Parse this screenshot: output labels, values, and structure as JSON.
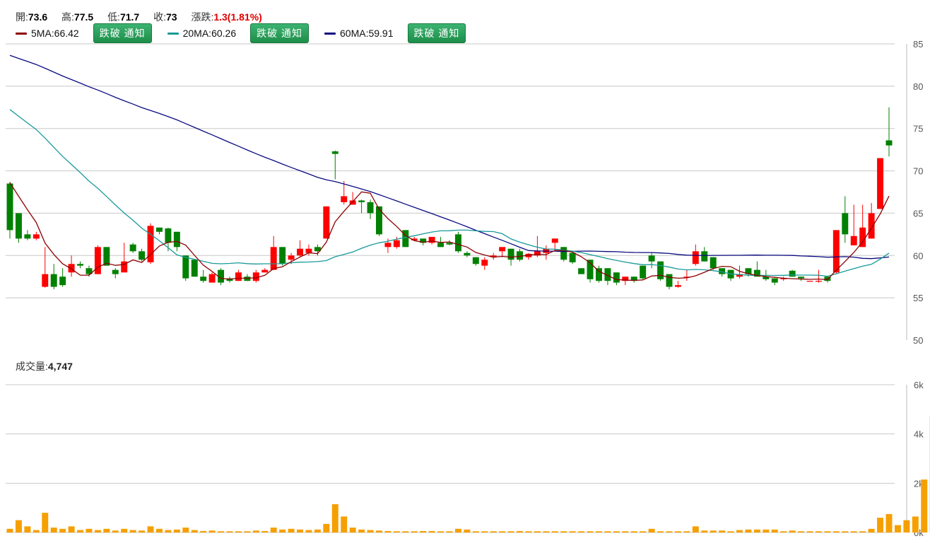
{
  "header": {
    "open_label": "開:",
    "open": "73.6",
    "high_label": "高:",
    "high": "77.5",
    "low_label": "低:",
    "low": "71.7",
    "close_label": "收:",
    "close": "73",
    "change_label": "漲跌:",
    "change": "1.3(1.81%)"
  },
  "ma": [
    {
      "label": "5MA:66.42",
      "color": "#8b0000"
    },
    {
      "label": "20MA:60.26",
      "color": "#1a9a9a"
    },
    {
      "label": "60MA:59.91",
      "color": "#0a0a80"
    }
  ],
  "alert_button_label": "跌破 通知",
  "volume_header": {
    "label": "成交量:",
    "value": "4,747"
  },
  "colors": {
    "up": "#ff0000",
    "down": "#008000",
    "volume": "#f5a000",
    "grid": "#c8c8c8"
  },
  "chart_data": [
    {
      "type": "candlestick",
      "ylim": [
        50,
        85
      ],
      "yticks": [
        "85",
        "80",
        "75",
        "70",
        "65",
        "60",
        "55",
        "50"
      ],
      "candles": [
        [
          68.5,
          63,
          68.7,
          62
        ],
        [
          65,
          62,
          65,
          61.5
        ],
        [
          62.5,
          62,
          63,
          61.8
        ],
        [
          62,
          62.5,
          62.8,
          61.8
        ],
        [
          56.3,
          57.8,
          61,
          56.2
        ],
        [
          57.8,
          56.3,
          59,
          56
        ],
        [
          57.5,
          56.5,
          58.5,
          56.3
        ],
        [
          58,
          59,
          60,
          57.5
        ],
        [
          59,
          58.8,
          59.3,
          58.5
        ],
        [
          58.5,
          57.8,
          58.8,
          57.5
        ],
        [
          57.8,
          61,
          61.2,
          57.8
        ],
        [
          61,
          58.8,
          61,
          58.8
        ],
        [
          58.3,
          57.8,
          58.5,
          57.3
        ],
        [
          58,
          59.3,
          61.5,
          58
        ],
        [
          61.3,
          60.5,
          61.5,
          60.3
        ],
        [
          60.5,
          59.5,
          60.8,
          59.3
        ],
        [
          59.2,
          63.5,
          63.8,
          59
        ],
        [
          63.3,
          62.8,
          63.3,
          62.5
        ],
        [
          63.2,
          61.5,
          63.3,
          60.5
        ],
        [
          62.8,
          61,
          62.8,
          60.5
        ],
        [
          60,
          57.3,
          60,
          57
        ],
        [
          59.5,
          57.5,
          59.5,
          57.5
        ],
        [
          57.5,
          57,
          58.3,
          56.8
        ],
        [
          56.8,
          57.8,
          58,
          56.8
        ],
        [
          58.3,
          56.8,
          58.5,
          56.5
        ],
        [
          57.3,
          57,
          57.5,
          56.8
        ],
        [
          57,
          58,
          58.3,
          57
        ],
        [
          57.5,
          57,
          57.8,
          57
        ],
        [
          57,
          58,
          58.3,
          56.8
        ],
        [
          58,
          58.3,
          58.5,
          58
        ],
        [
          58.3,
          61,
          62.3,
          58.3
        ],
        [
          61,
          59,
          61,
          58.8
        ],
        [
          59.5,
          60,
          60.3,
          59
        ],
        [
          60,
          60.8,
          61.8,
          59.8
        ],
        [
          60.3,
          60.8,
          61.3,
          60
        ],
        [
          61,
          60.5,
          61.3,
          60
        ],
        [
          62,
          65.8,
          65.8,
          62
        ],
        [
          72.3,
          72,
          72.4,
          69
        ],
        [
          66.3,
          67,
          68.8,
          66
        ],
        [
          66,
          66.5,
          67.5,
          66
        ],
        [
          66.5,
          66.3,
          66.6,
          65
        ],
        [
          66.3,
          65,
          66.6,
          64.3
        ],
        [
          65.8,
          62.5,
          65.8,
          62.3
        ],
        [
          61,
          61.5,
          62,
          60.3
        ],
        [
          61,
          61.8,
          62.2,
          60.8
        ],
        [
          63,
          61,
          63,
          61
        ],
        [
          61.8,
          62,
          62.2,
          61.8
        ],
        [
          62,
          61.5,
          62,
          61.2
        ],
        [
          61.5,
          62.2,
          62.2,
          61.3
        ],
        [
          61.5,
          61,
          62.2,
          61
        ],
        [
          61.5,
          61.3,
          61.8,
          61.2
        ],
        [
          62.5,
          60.5,
          62.8,
          60.3
        ],
        [
          60.3,
          60,
          60.5,
          59.8
        ],
        [
          59.8,
          59,
          59.8,
          58.8
        ],
        [
          58.8,
          59.5,
          59.8,
          58.3
        ],
        [
          59.8,
          60,
          60.3,
          59.5
        ],
        [
          60.5,
          61,
          61,
          59.8
        ],
        [
          60.8,
          59.5,
          60.8,
          58.8
        ],
        [
          60.5,
          59.5,
          60.8,
          59.3
        ],
        [
          59.8,
          60.2,
          60.3,
          59.5
        ],
        [
          60,
          60.5,
          62.3,
          59.8
        ],
        [
          60.3,
          60.8,
          61.2,
          59.5
        ],
        [
          61.5,
          62,
          62,
          60.5
        ],
        [
          61,
          59.5,
          61,
          59.3
        ],
        [
          60.3,
          59.2,
          60.5,
          59
        ],
        [
          58.5,
          57.8,
          58.5,
          57.8
        ],
        [
          59.5,
          57.2,
          59.5,
          56.8
        ],
        [
          58.5,
          57,
          58.8,
          56.8
        ],
        [
          58.5,
          57,
          58.5,
          56.5
        ],
        [
          58,
          56.8,
          58,
          56.5
        ],
        [
          57,
          57.5,
          57.5,
          56.5
        ],
        [
          57.5,
          57,
          57.5,
          56.8
        ],
        [
          58.8,
          57.3,
          58.8,
          57.2
        ],
        [
          60,
          59.3,
          60.3,
          58.5
        ],
        [
          59.3,
          57.2,
          59.3,
          57
        ],
        [
          57.8,
          56.3,
          57.8,
          56
        ],
        [
          56.3,
          56.5,
          57,
          56.2
        ],
        [
          57.5,
          57.5,
          58.3,
          57
        ],
        [
          59,
          60.5,
          61.3,
          58.8
        ],
        [
          60.5,
          59.3,
          61,
          59.3
        ],
        [
          59.8,
          58.5,
          59.8,
          58.3
        ],
        [
          58.5,
          57.8,
          58.5,
          57.5
        ],
        [
          58.3,
          57.3,
          58.3,
          57
        ],
        [
          57.5,
          57.8,
          58.8,
          57.3
        ],
        [
          58.5,
          57.8,
          58.5,
          57.5
        ],
        [
          58.3,
          57.5,
          59.3,
          57.5
        ],
        [
          57.5,
          57.2,
          58.3,
          57
        ],
        [
          57.3,
          56.8,
          57.3,
          56.5
        ],
        [
          57.3,
          57.3,
          57.5,
          57
        ],
        [
          58.2,
          57.5,
          58.3,
          57.5
        ],
        [
          57.5,
          57.3,
          57.5,
          57
        ],
        [
          57,
          57,
          57,
          57
        ],
        [
          57,
          57,
          58.3,
          56.8
        ],
        [
          57.5,
          57,
          57.5,
          56.8
        ],
        [
          58,
          63,
          63,
          57.8
        ],
        [
          65,
          62.5,
          67,
          61.5
        ],
        [
          61.2,
          62.3,
          66,
          61.2
        ],
        [
          61,
          63.3,
          66,
          61
        ],
        [
          62,
          65,
          66.2,
          62
        ],
        [
          65.5,
          71.5,
          71.5,
          65.5
        ],
        [
          73.6,
          73,
          77.5,
          71.7
        ]
      ]
    },
    {
      "type": "bar",
      "ylim": [
        0,
        6000
      ],
      "yticks": [
        "6k",
        "4k",
        "2k",
        "0k"
      ],
      "values": [
        150,
        500,
        250,
        100,
        800,
        200,
        150,
        250,
        100,
        150,
        100,
        150,
        80,
        150,
        100,
        80,
        250,
        150,
        100,
        120,
        200,
        100,
        60,
        80,
        50,
        50,
        50,
        50,
        80,
        60,
        200,
        120,
        150,
        120,
        100,
        120,
        350,
        1150,
        650,
        200,
        120,
        100,
        80,
        60,
        50,
        50,
        50,
        60,
        60,
        50,
        50,
        150,
        120,
        50,
        50,
        50,
        50,
        50,
        60,
        50,
        50,
        50,
        50,
        50,
        50,
        50,
        50,
        50,
        50,
        50,
        50,
        50,
        50,
        150,
        50,
        50,
        50,
        50,
        250,
        80,
        80,
        80,
        50,
        100,
        120,
        120,
        120,
        120,
        50,
        80,
        50,
        50,
        50,
        50,
        50,
        50,
        50,
        50,
        150,
        600,
        750,
        300,
        500,
        650,
        2150,
        4747
      ]
    }
  ]
}
